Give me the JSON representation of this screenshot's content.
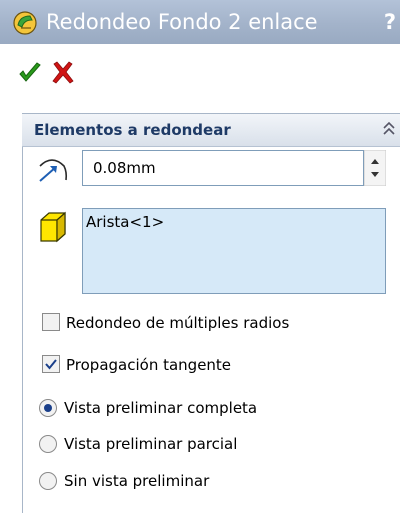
{
  "title": {
    "text": "Redondeo Fondo 2 enlace",
    "help": "?",
    "icon": "fillet-feature-icon"
  },
  "actions": {
    "ok_icon": "checkmark-icon",
    "cancel_icon": "x-icon"
  },
  "group": {
    "title": "Elementos a redondear",
    "collapse_icon": "double-chevron-up-icon",
    "radius": {
      "icon": "radius-arc-icon",
      "value": "0.08mm"
    },
    "edges": {
      "icon": "cube-icon",
      "items": [
        "Arista<1>"
      ]
    },
    "checkboxes": [
      {
        "label": "Redondeo de múltiples radios",
        "checked": false
      },
      {
        "label": "Propagación tangente",
        "checked": true
      }
    ],
    "preview_options": [
      {
        "label": "Vista preliminar completa",
        "selected": true
      },
      {
        "label": "Vista preliminar parcial",
        "selected": false
      },
      {
        "label": "Sin vista preliminar",
        "selected": false
      }
    ]
  },
  "colors": {
    "titlebar": "#a3b3ca",
    "group_title": "#1e3a66",
    "list_selection": "#d6e9f8",
    "ok_green": "#2a9a1c",
    "cancel_red": "#d01414"
  }
}
